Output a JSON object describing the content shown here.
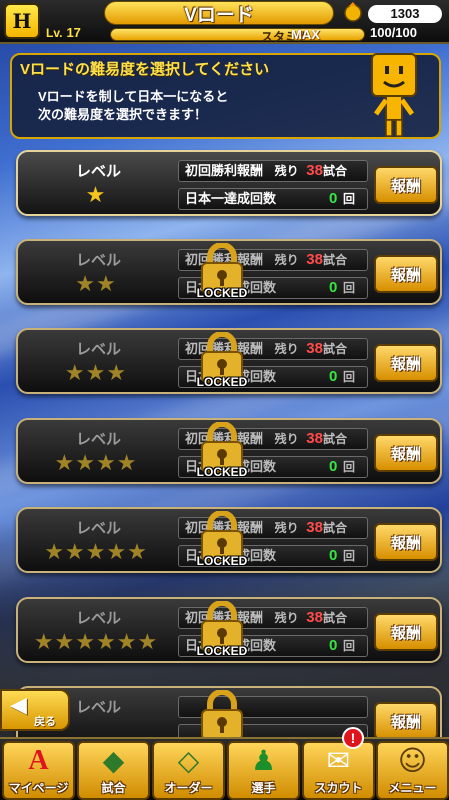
{
  "header": {
    "logo_text": "H",
    "title": "Vロード",
    "coins": "1303",
    "level_label": "Lv.",
    "level": "17",
    "stamina_label": "スタミナ",
    "stamina_max": "MAX",
    "stamina_value": "100/100",
    "stamina_fill": 1.0
  },
  "info": {
    "heading": "Vロードの難易度を選択してください",
    "line1": "Vロードを制して日本一になると",
    "line2": "次の難易度を選択できます！"
  },
  "levels": [
    {
      "label": "レベル",
      "stars": "★",
      "first_win_label": "初回勝利報酬",
      "remaining_label": "残り",
      "remaining": "38",
      "games_unit": "試合",
      "champ_label": "日本一達成回数",
      "champ_count": "0",
      "champ_unit": "回",
      "reward": "報酬",
      "locked": false
    },
    {
      "label": "レベル",
      "stars": "★★",
      "first_win_label": "初回勝利報酬",
      "remaining_label": "残り",
      "remaining": "38",
      "games_unit": "試合",
      "champ_label": "日本一達成回数",
      "champ_count": "0",
      "champ_unit": "回",
      "reward": "報酬",
      "locked": true,
      "lock_text": "LOCKED"
    },
    {
      "label": "レベル",
      "stars": "★★★",
      "first_win_label": "初回勝利報酬",
      "remaining_label": "残り",
      "remaining": "38",
      "games_unit": "試合",
      "champ_label": "日本一達成回数",
      "champ_count": "0",
      "champ_unit": "回",
      "reward": "報酬",
      "locked": true,
      "lock_text": "LOCKED"
    },
    {
      "label": "レベル",
      "stars": "★★★★",
      "first_win_label": "初回勝利報酬",
      "remaining_label": "残り",
      "remaining": "38",
      "games_unit": "試合",
      "champ_label": "日本一達成回数",
      "champ_count": "0",
      "champ_unit": "回",
      "reward": "報酬",
      "locked": true,
      "lock_text": "LOCKED"
    },
    {
      "label": "レベル",
      "stars": "★★★★★",
      "first_win_label": "初回勝利報酬",
      "remaining_label": "残り",
      "remaining": "38",
      "games_unit": "試合",
      "champ_label": "日本一達成回数",
      "champ_count": "0",
      "champ_unit": "回",
      "reward": "報酬",
      "locked": true,
      "lock_text": "LOCKED"
    },
    {
      "label": "レベル",
      "stars": "★★★★★★",
      "first_win_label": "初回勝利報酬",
      "remaining_label": "残り",
      "remaining": "38",
      "games_unit": "試合",
      "champ_label": "日本一達成回数",
      "champ_count": "0",
      "champ_unit": "回",
      "reward": "報酬",
      "locked": true,
      "lock_text": "LOCKED"
    },
    {
      "label": "レベル",
      "stars": "",
      "first_win_label": "",
      "remaining_label": "",
      "remaining": "",
      "games_unit": "",
      "champ_label": "",
      "champ_count": "",
      "champ_unit": "",
      "reward": "報酬",
      "locked": true,
      "lock_text": ""
    }
  ],
  "back": {
    "label": "戻る"
  },
  "nav": [
    {
      "label": "マイページ",
      "icon": "A"
    },
    {
      "label": "試合",
      "icon": "◆"
    },
    {
      "label": "オーダー",
      "icon": "◇"
    },
    {
      "label": "選手",
      "icon": "♟"
    },
    {
      "label": "スカウト",
      "icon": "✉"
    },
    {
      "label": "メニュー",
      "icon": "☺"
    }
  ],
  "notification_badge": "!",
  "colors": {
    "accent": "#e8a300",
    "gold_border": "#d6a500",
    "red": "#ff4b4b",
    "green": "#35e640"
  }
}
